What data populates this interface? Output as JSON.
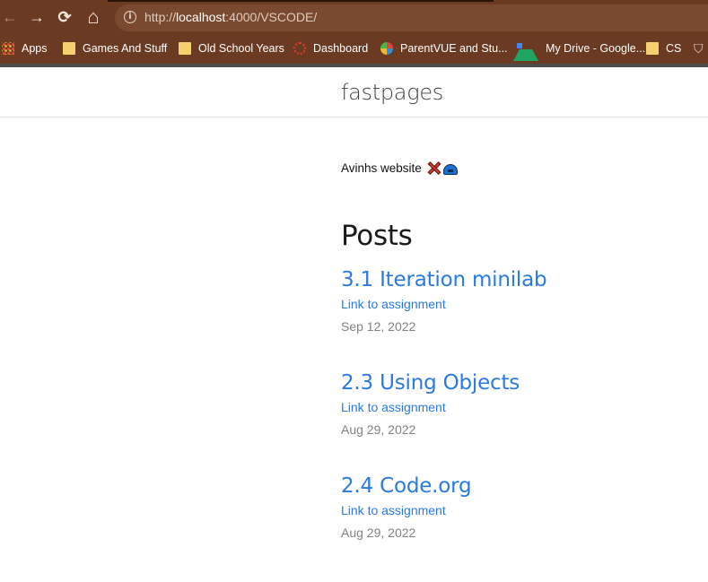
{
  "browser": {
    "url_prefix": "http://",
    "url_host": "localhost",
    "url_rest": ":4000/VSCODE/",
    "nav_icons": {
      "back": "←",
      "forward": "→",
      "reload": "⟳",
      "home": "⌂",
      "info": "i"
    }
  },
  "bookmarks": [
    {
      "label": "Apps",
      "icon": "apps-icon"
    },
    {
      "label": "Games And Stuff",
      "icon": "folder-icon"
    },
    {
      "label": "Old School Years",
      "icon": "folder-icon"
    },
    {
      "label": "Dashboard",
      "icon": "dashboard-icon"
    },
    {
      "label": "ParentVUE and Stu...",
      "icon": "parentvue-icon"
    },
    {
      "label": "My Drive - Google...",
      "icon": "google-drive-icon"
    },
    {
      "label": "CS",
      "icon": "folder-icon"
    }
  ],
  "site": {
    "title": "fastpages",
    "intro": "Avinhs website"
  },
  "posts_heading": "Posts",
  "posts": [
    {
      "title": "3.1 Iteration minilab",
      "description": "Link to assignment",
      "date": "Sep 12, 2022"
    },
    {
      "title": "2.3 Using Objects",
      "description": "Link to assignment",
      "date": "Aug 29, 2022"
    },
    {
      "title": "2.4 Code.org",
      "description": "Link to assignment",
      "date": "Aug 29, 2022"
    }
  ],
  "colors": {
    "chrome_bg": "#6a3a22",
    "link": "#2a7ae2",
    "date": "#828282"
  }
}
